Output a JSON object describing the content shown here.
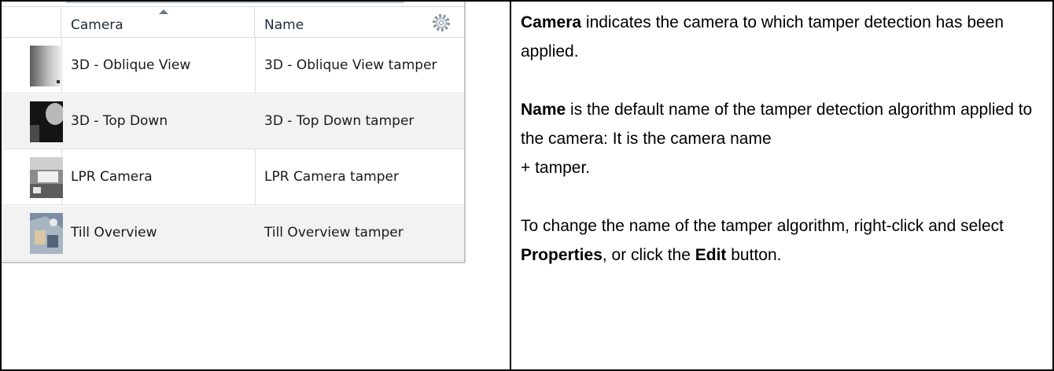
{
  "listview": {
    "columns": {
      "camera": "Camera",
      "name": "Name"
    },
    "rows": [
      {
        "camera": "3D - Oblique View",
        "name": "3D - Oblique View tamper"
      },
      {
        "camera": "3D - Top Down",
        "name": "3D - Top Down tamper"
      },
      {
        "camera": "LPR Camera",
        "name": "LPR Camera tamper"
      },
      {
        "camera": "Till Overview",
        "name": "Till Overview tamper"
      }
    ]
  },
  "description": {
    "camera_term": "Camera",
    "camera_text": " indicates the camera to which tamper detection has been applied.",
    "name_term": "Name",
    "name_text": " is the default name of the tamper detection algorithm applied to the camera: It is the camera name",
    "name_suffix": "+ tamper.",
    "change_text_1": "To change the name of the tamper algorithm, right-click and select ",
    "properties_term": "Properties",
    "change_text_2": ", or click the ",
    "edit_term": "Edit",
    "change_text_3": " button."
  }
}
